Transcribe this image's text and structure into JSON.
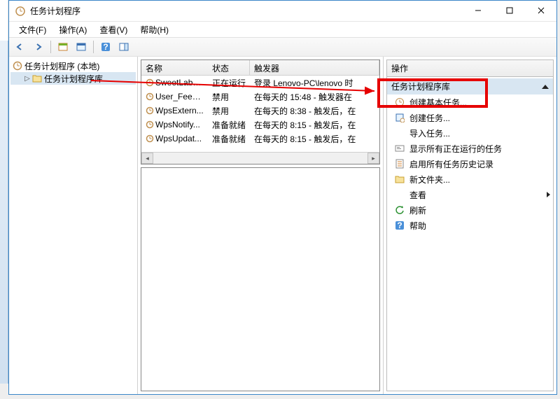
{
  "window": {
    "title": "任务计划程序"
  },
  "menu": {
    "file": "文件(F)",
    "action": "操作(A)",
    "view": "查看(V)",
    "help": "帮助(H)"
  },
  "tree": {
    "root": "任务计划程序 (本地)",
    "lib": "任务计划程序库"
  },
  "list": {
    "headers": {
      "name": "名称",
      "status": "状态",
      "trigger": "触发器"
    },
    "rows": [
      {
        "name": "SweetLabs ...",
        "status": "正在运行",
        "trigger": "登录 Lenovo-PC\\lenovo 时"
      },
      {
        "name": "User_Feed_...",
        "status": "禁用",
        "trigger": "在每天的 15:48 - 触发器在"
      },
      {
        "name": "WpsExtern...",
        "status": "禁用",
        "trigger": "在每天的 8:38 - 触发后，在"
      },
      {
        "name": "WpsNotify...",
        "status": "准备就绪",
        "trigger": "在每天的 8:15 - 触发后，在"
      },
      {
        "name": "WpsUpdat...",
        "status": "准备就绪",
        "trigger": "在每天的 8:15 - 触发后，在"
      }
    ]
  },
  "actions": {
    "title": "操作",
    "section": "任务计划程序库",
    "items": {
      "create_basic": "创建基本任务...",
      "create_task": "创建任务...",
      "import_task": "导入任务...",
      "show_running": "显示所有正在运行的任务",
      "enable_history": "启用所有任务历史记录",
      "new_folder": "新文件夹...",
      "view": "查看",
      "refresh": "刷新",
      "help": "帮助"
    }
  }
}
